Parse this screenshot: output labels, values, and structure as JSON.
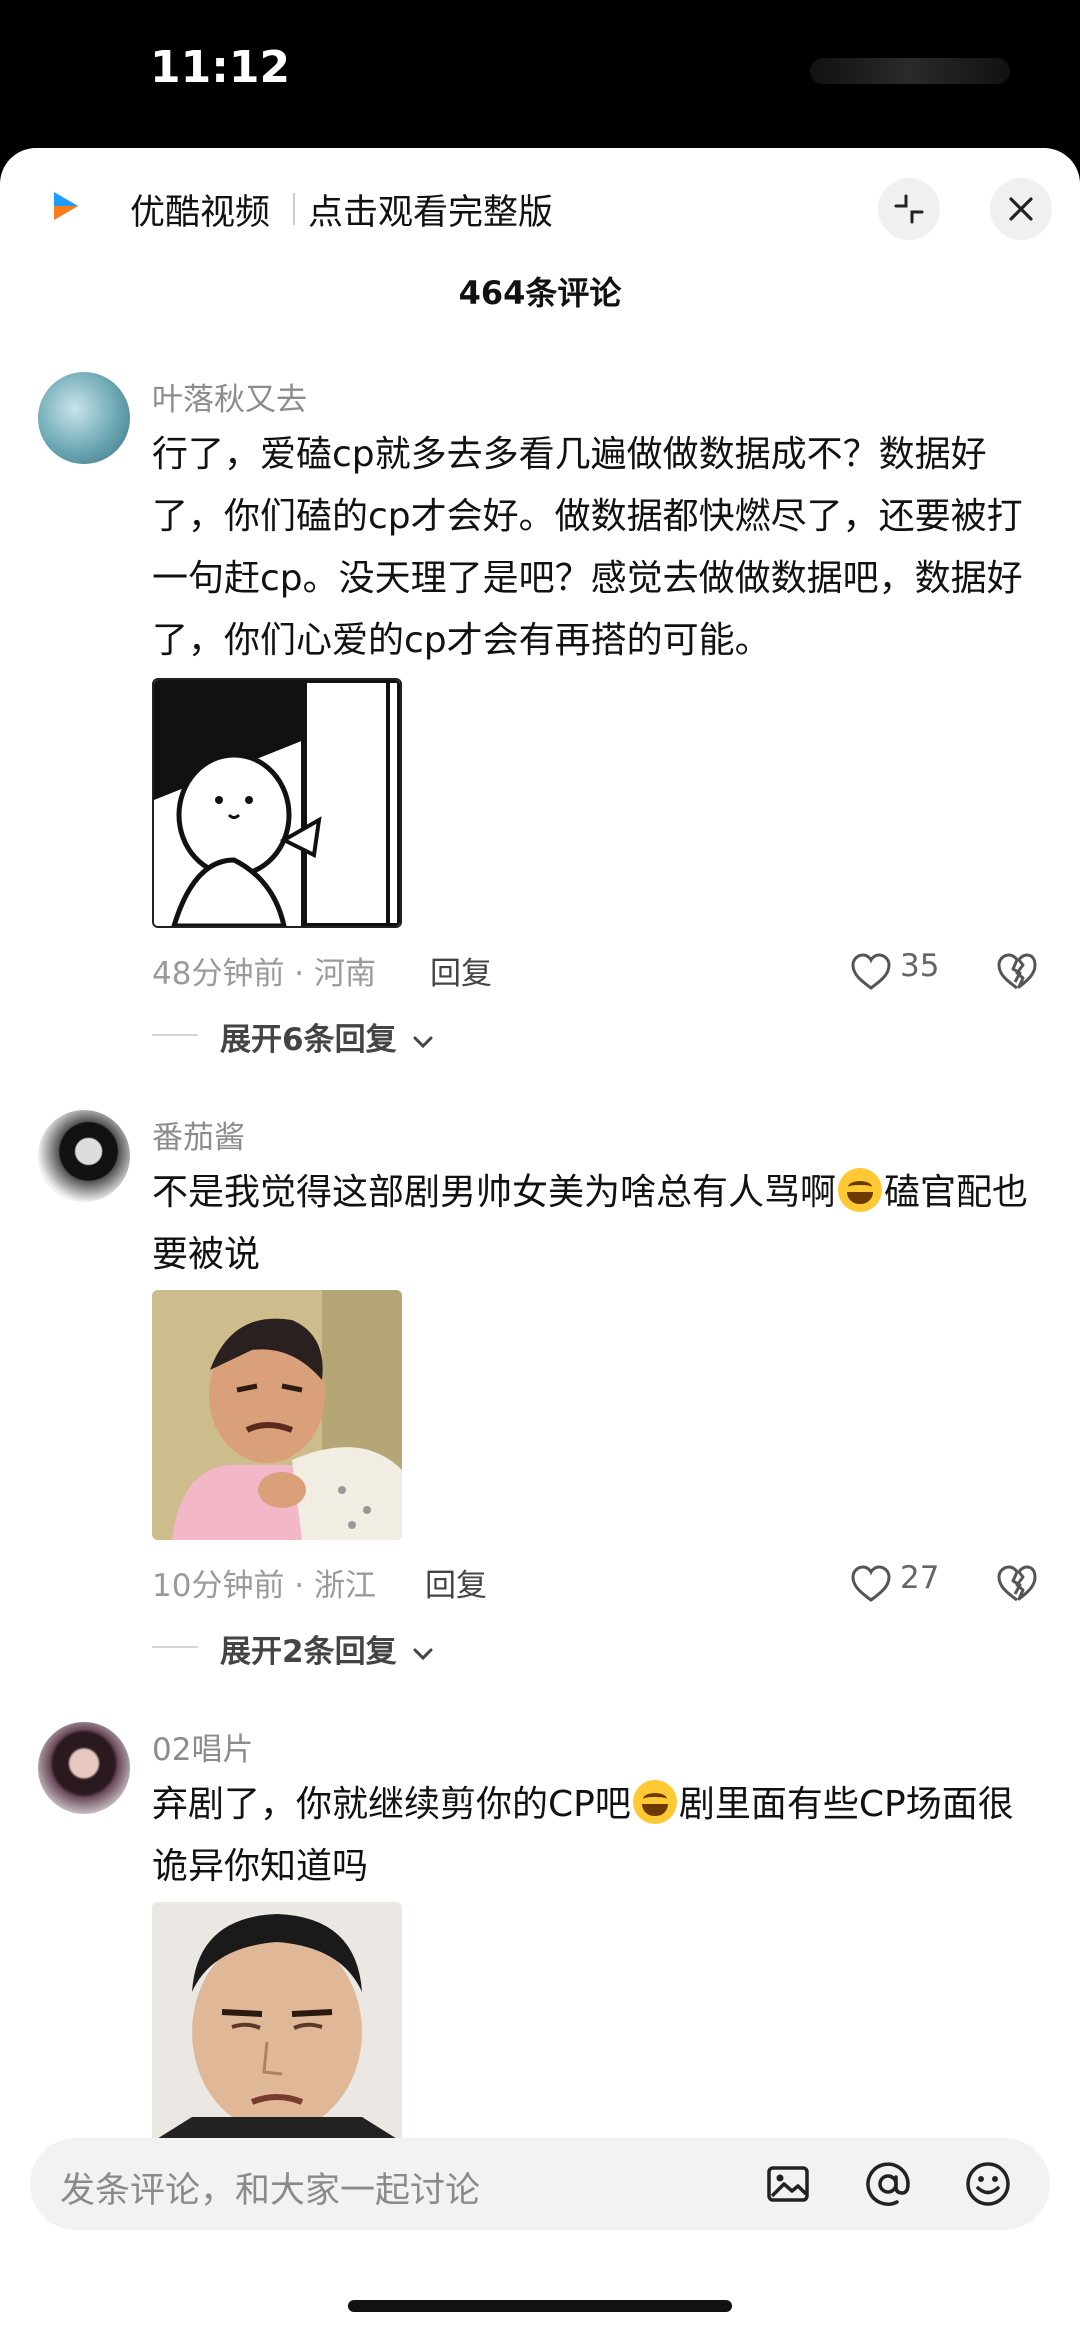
{
  "status_bar": {
    "time": "11:12"
  },
  "header": {
    "app_name": "优酷视频",
    "cta": "点击观看完整版",
    "comment_count": "464条评论"
  },
  "comments": [
    {
      "username": "叶落秋又去",
      "text": "行了，爱磕cp就多去多看几遍做做数据成不？数据好了，你们磕的cp才会好。做数据都快燃尽了，还要被打一句赶cp。没天理了是吧？感觉去做做数据吧，数据好了，你们心爱的cp才会有再搭的可能。",
      "meta": "48分钟前 · 河南",
      "reply": "回复",
      "likes": "35",
      "expand": "展开6条回复",
      "sticker": "cartoon-cat-door-sticker"
    },
    {
      "username": "番茄酱",
      "text_before_emoji": "不是我觉得这部剧男帅女美为啥总有人骂啊",
      "text_after_emoji": "磕官配也要被说",
      "meta": "10分钟前 · 浙江",
      "reply": "回复",
      "likes": "27",
      "expand": "展开2条回复",
      "sticker": "man-grimace-sticker"
    },
    {
      "username": "02唱片",
      "text_before_emoji": "弃剧了，你就继续剪你的CP吧",
      "text_after_emoji": "剧里面有些CP场面很诡异你知道吗",
      "sticker": "man-squint-sticker"
    }
  ],
  "composer": {
    "placeholder": "发条评论，和大家一起讨论"
  },
  "colors": {
    "accent_blue": "#1e9bff",
    "accent_orange": "#ff7a1a"
  }
}
